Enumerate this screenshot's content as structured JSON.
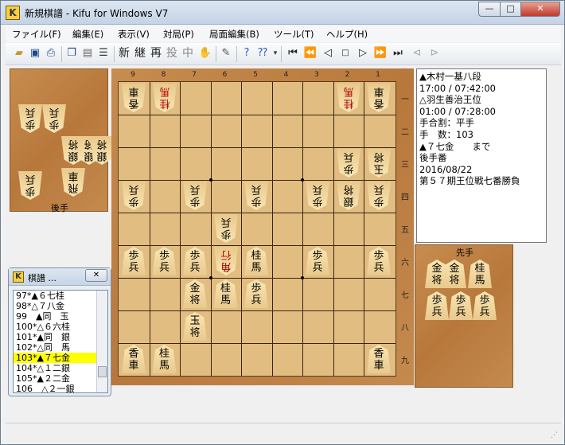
{
  "window": {
    "title": "新規棋譜 - Kifu for Windows V7",
    "app_icon_letter": "K",
    "btn_min": "—",
    "btn_max": "□",
    "btn_close": "✕"
  },
  "menu": [
    "ファイル(F)",
    "編集(E)",
    "表示(V)",
    "対局(P)",
    "局面編集(B)",
    "ツール(T)",
    "ヘルプ(H)"
  ],
  "toolbar": {
    "kanji_buttons": [
      "新",
      "継",
      "再",
      "投",
      "中"
    ],
    "nav_icons": [
      "first-icon",
      "back-10-icon",
      "back-icon",
      "stop-icon",
      "forward-icon",
      "forward-10-icon",
      "last-icon",
      "branch-back-icon",
      "branch-forward-icon"
    ]
  },
  "board": {
    "file_labels": [
      "9",
      "8",
      "7",
      "6",
      "5",
      "4",
      "3",
      "2",
      "1"
    ],
    "rank_labels": [
      "一",
      "二",
      "三",
      "四",
      "五",
      "六",
      "七",
      "八",
      "九"
    ],
    "pieces": [
      {
        "sq": "91",
        "k": "香車",
        "side": "gote"
      },
      {
        "sq": "81",
        "k": "桂馬",
        "side": "gote",
        "promoted": true
      },
      {
        "sq": "21",
        "k": "桂馬",
        "side": "gote",
        "promoted": true
      },
      {
        "sq": "11",
        "k": "香車",
        "side": "gote"
      },
      {
        "sq": "23",
        "k": "歩兵",
        "side": "gote"
      },
      {
        "sq": "13",
        "k": "玉将",
        "side": "gote"
      },
      {
        "sq": "94",
        "k": "歩兵",
        "side": "gote"
      },
      {
        "sq": "74",
        "k": "歩兵",
        "side": "gote"
      },
      {
        "sq": "54",
        "k": "歩兵",
        "side": "gote"
      },
      {
        "sq": "34",
        "k": "歩兵",
        "side": "gote"
      },
      {
        "sq": "24",
        "k": "銀将",
        "side": "gote"
      },
      {
        "sq": "14",
        "k": "歩兵",
        "side": "gote"
      },
      {
        "sq": "65",
        "k": "歩兵",
        "side": "gote"
      },
      {
        "sq": "96",
        "k": "歩兵",
        "side": "sente"
      },
      {
        "sq": "86",
        "k": "歩兵",
        "side": "sente"
      },
      {
        "sq": "76",
        "k": "歩兵",
        "side": "sente"
      },
      {
        "sq": "66",
        "k": "角行",
        "side": "gote",
        "promoted": true
      },
      {
        "sq": "56",
        "k": "桂馬",
        "side": "sente"
      },
      {
        "sq": "36",
        "k": "歩兵",
        "side": "sente"
      },
      {
        "sq": "16",
        "k": "歩兵",
        "side": "sente"
      },
      {
        "sq": "77",
        "k": "金将",
        "side": "sente"
      },
      {
        "sq": "67",
        "k": "桂馬",
        "side": "sente"
      },
      {
        "sq": "57",
        "k": "歩兵",
        "side": "sente"
      },
      {
        "sq": "78",
        "k": "玉将",
        "side": "sente"
      },
      {
        "sq": "99",
        "k": "香車",
        "side": "sente"
      },
      {
        "sq": "89",
        "k": "桂馬",
        "side": "sente"
      },
      {
        "sq": "19",
        "k": "香車",
        "side": "sente"
      }
    ]
  },
  "gote_hand": {
    "label": "後手",
    "pieces": [
      "歩兵",
      "歩兵",
      "銀将",
      "銀将",
      "銀将",
      "歩兵",
      "飛車"
    ]
  },
  "sente_hand": {
    "label": "先手",
    "pieces": [
      "金将",
      "金将",
      "桂馬",
      "歩兵",
      "歩兵",
      "歩兵"
    ]
  },
  "info": {
    "lines": [
      "▲木村一基八段",
      "17:00 / 07:42:00",
      "△羽生善治王位",
      "01:00 / 07:28:00",
      "手合割：平手",
      "手　数：103",
      "▲７七金　　まで",
      "後手番",
      "2016/08/22",
      "第５７期王位戦七番勝負"
    ]
  },
  "kifu_window": {
    "title": "棋譜 ...",
    "close": "✕",
    "moves": [
      {
        "text": "97*▲６七桂",
        "selected": false
      },
      {
        "text": "98*△７八金",
        "selected": false
      },
      {
        "text": "99　▲同　玉",
        "selected": false
      },
      {
        "text": "100*△６六桂",
        "selected": false
      },
      {
        "text": "101*▲同　銀",
        "selected": false
      },
      {
        "text": "102*△同　馬",
        "selected": false
      },
      {
        "text": "103*▲７七金",
        "selected": true
      },
      {
        "text": "104*△１二銀",
        "selected": false
      },
      {
        "text": "105*▲２二金",
        "selected": false
      },
      {
        "text": "106　△２一銀",
        "selected": false
      }
    ]
  }
}
